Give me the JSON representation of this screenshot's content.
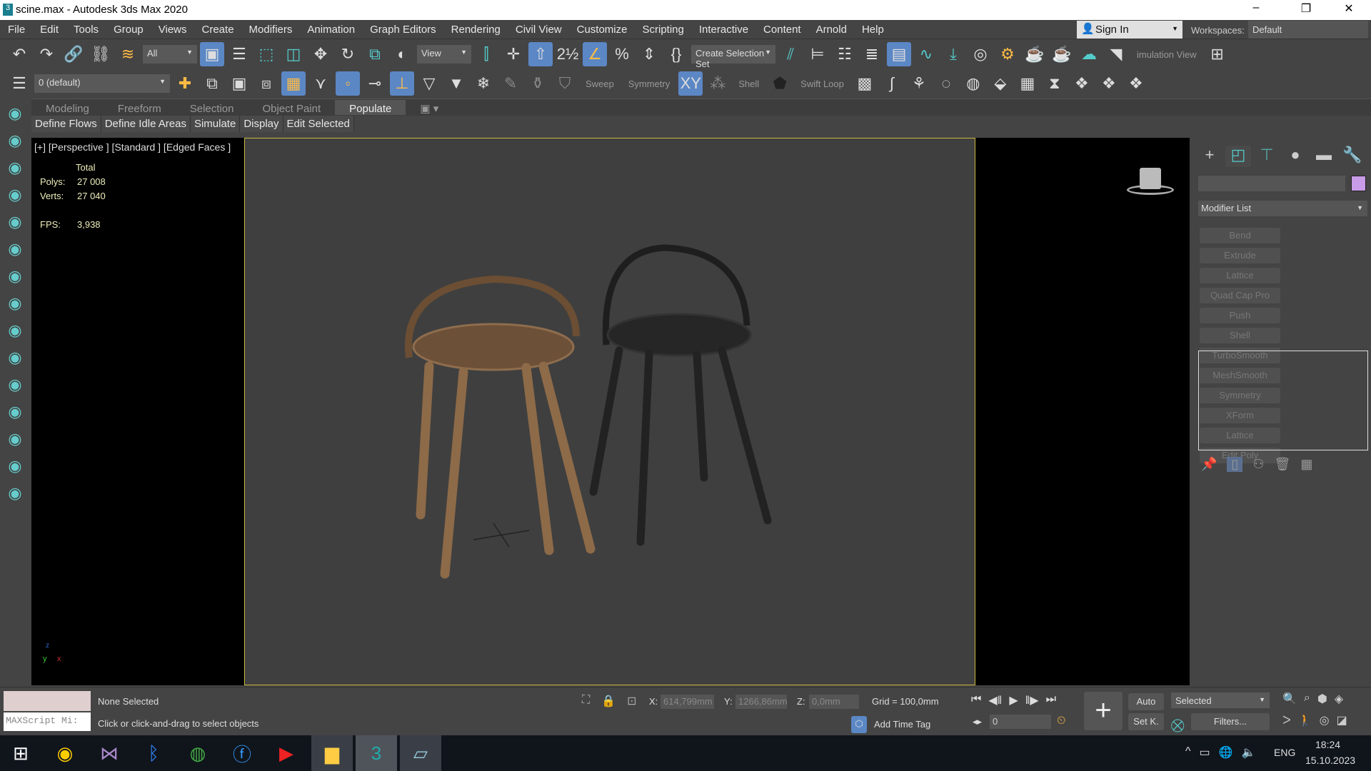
{
  "window": {
    "title": "scine.max - Autodesk 3ds Max 2020",
    "app_icon": "3",
    "min": "–",
    "max": "❐",
    "close": "✕"
  },
  "menu": [
    "File",
    "Edit",
    "Tools",
    "Group",
    "Views",
    "Create",
    "Modifiers",
    "Animation",
    "Graph Editors",
    "Rendering",
    "Civil View",
    "Customize",
    "Scripting",
    "Interactive",
    "Content",
    "Arnold",
    "Help"
  ],
  "account": {
    "sign_in": "Sign In",
    "workspaces_label": "Workspaces:",
    "workspace": "Default"
  },
  "toolbar1": {
    "filter": "All",
    "ref_coord": "View",
    "selection_set": "Create Selection Set",
    "sim_view": "imulation View"
  },
  "toolbar2": {
    "layer": "0 (default)",
    "sweep": "Sweep",
    "symmetry": "Symmetry",
    "shell": "Shell",
    "swift_loop": "Swift Loop"
  },
  "ribbon": {
    "tabs": [
      "Modeling",
      "Freeform",
      "Selection",
      "Object Paint",
      "Populate"
    ],
    "active": "Populate",
    "subtabs": [
      "Define Flows",
      "Define Idle Areas",
      "Simulate",
      "Display",
      "Edit Selected"
    ]
  },
  "viewport": {
    "label": "[+] [Perspective ] [Standard ] [Edged Faces ]",
    "total": "Total",
    "polys_label": "Polys:",
    "polys": "27 008",
    "verts_label": "Verts:",
    "verts": "27 040",
    "fps_label": "FPS:",
    "fps": "3,938",
    "axis_y": "y",
    "axis_x": "x",
    "axis_z": "z"
  },
  "command_panel": {
    "modifier_list": "Modifier List",
    "color_swatch": "#c89be8",
    "modifiers": [
      "Bend",
      "Extrude",
      "Lattice",
      "Quad Cap Pro",
      "Push",
      "Shell",
      "TurboSmooth",
      "MeshSmooth",
      "Symmetry",
      "XForm",
      "Lattice",
      "Edit Poly"
    ]
  },
  "status": {
    "maxscript": "MAXScript Mi:",
    "selection": "None Selected",
    "prompt": "Click or click-and-drag to select objects",
    "x_label": "X:",
    "x": "614,799mm",
    "y_label": "Y:",
    "y": "1266,86mm",
    "z_label": "Z:",
    "z": "0,0mm",
    "grid": "Grid = 100,0mm",
    "add_time_tag": "Add Time Tag",
    "frame": "0",
    "auto": "Auto",
    "set_key": "Set K.",
    "key_filter": "Selected",
    "filters": "Filters..."
  },
  "taskbar": {
    "lang": "ENG",
    "time": "18:24",
    "date": "15.10.2023"
  }
}
